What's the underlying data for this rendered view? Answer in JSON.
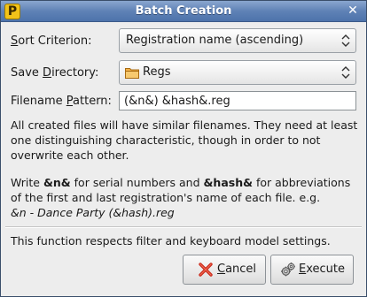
{
  "window": {
    "title": "Batch Creation",
    "app_icon_letter": "P",
    "close_glyph": "✕"
  },
  "sort": {
    "label_prefix": "",
    "label_ul": "S",
    "label_rest": "ort Criterion:",
    "value": "Registration name (ascending)"
  },
  "save": {
    "label_prefix": "Save ",
    "label_ul": "D",
    "label_rest": "irectory:",
    "value": "Regs"
  },
  "pattern": {
    "label_prefix": "Filename ",
    "label_ul": "P",
    "label_rest": "attern:",
    "value": "(&n&) &hash&.reg"
  },
  "info": {
    "line1": "All created files will have similar filenames. They need at least",
    "line2": "one distinguishing characteristic, though in order to not",
    "line3": "overwrite each other."
  },
  "hint": {
    "write": "Write ",
    "serial_token": "&n&",
    "serial_text": " for serial numbers and ",
    "hash_token": "&hash&",
    "hash_text": " for abbreviations",
    "line2": "of the first and last registration's name of each file. e.g.",
    "example": "&n - Dance Party (&hash).reg"
  },
  "notice": "This function respects filter and keyboard model settings.",
  "buttons": {
    "cancel": {
      "ul": "C",
      "rest": "ancel"
    },
    "execute": {
      "ul": "E",
      "rest": "xecute"
    }
  },
  "colors": {
    "titlebar": "#5f82b6",
    "folder": "#f0a030",
    "cancel_icon": "#d8301e"
  }
}
